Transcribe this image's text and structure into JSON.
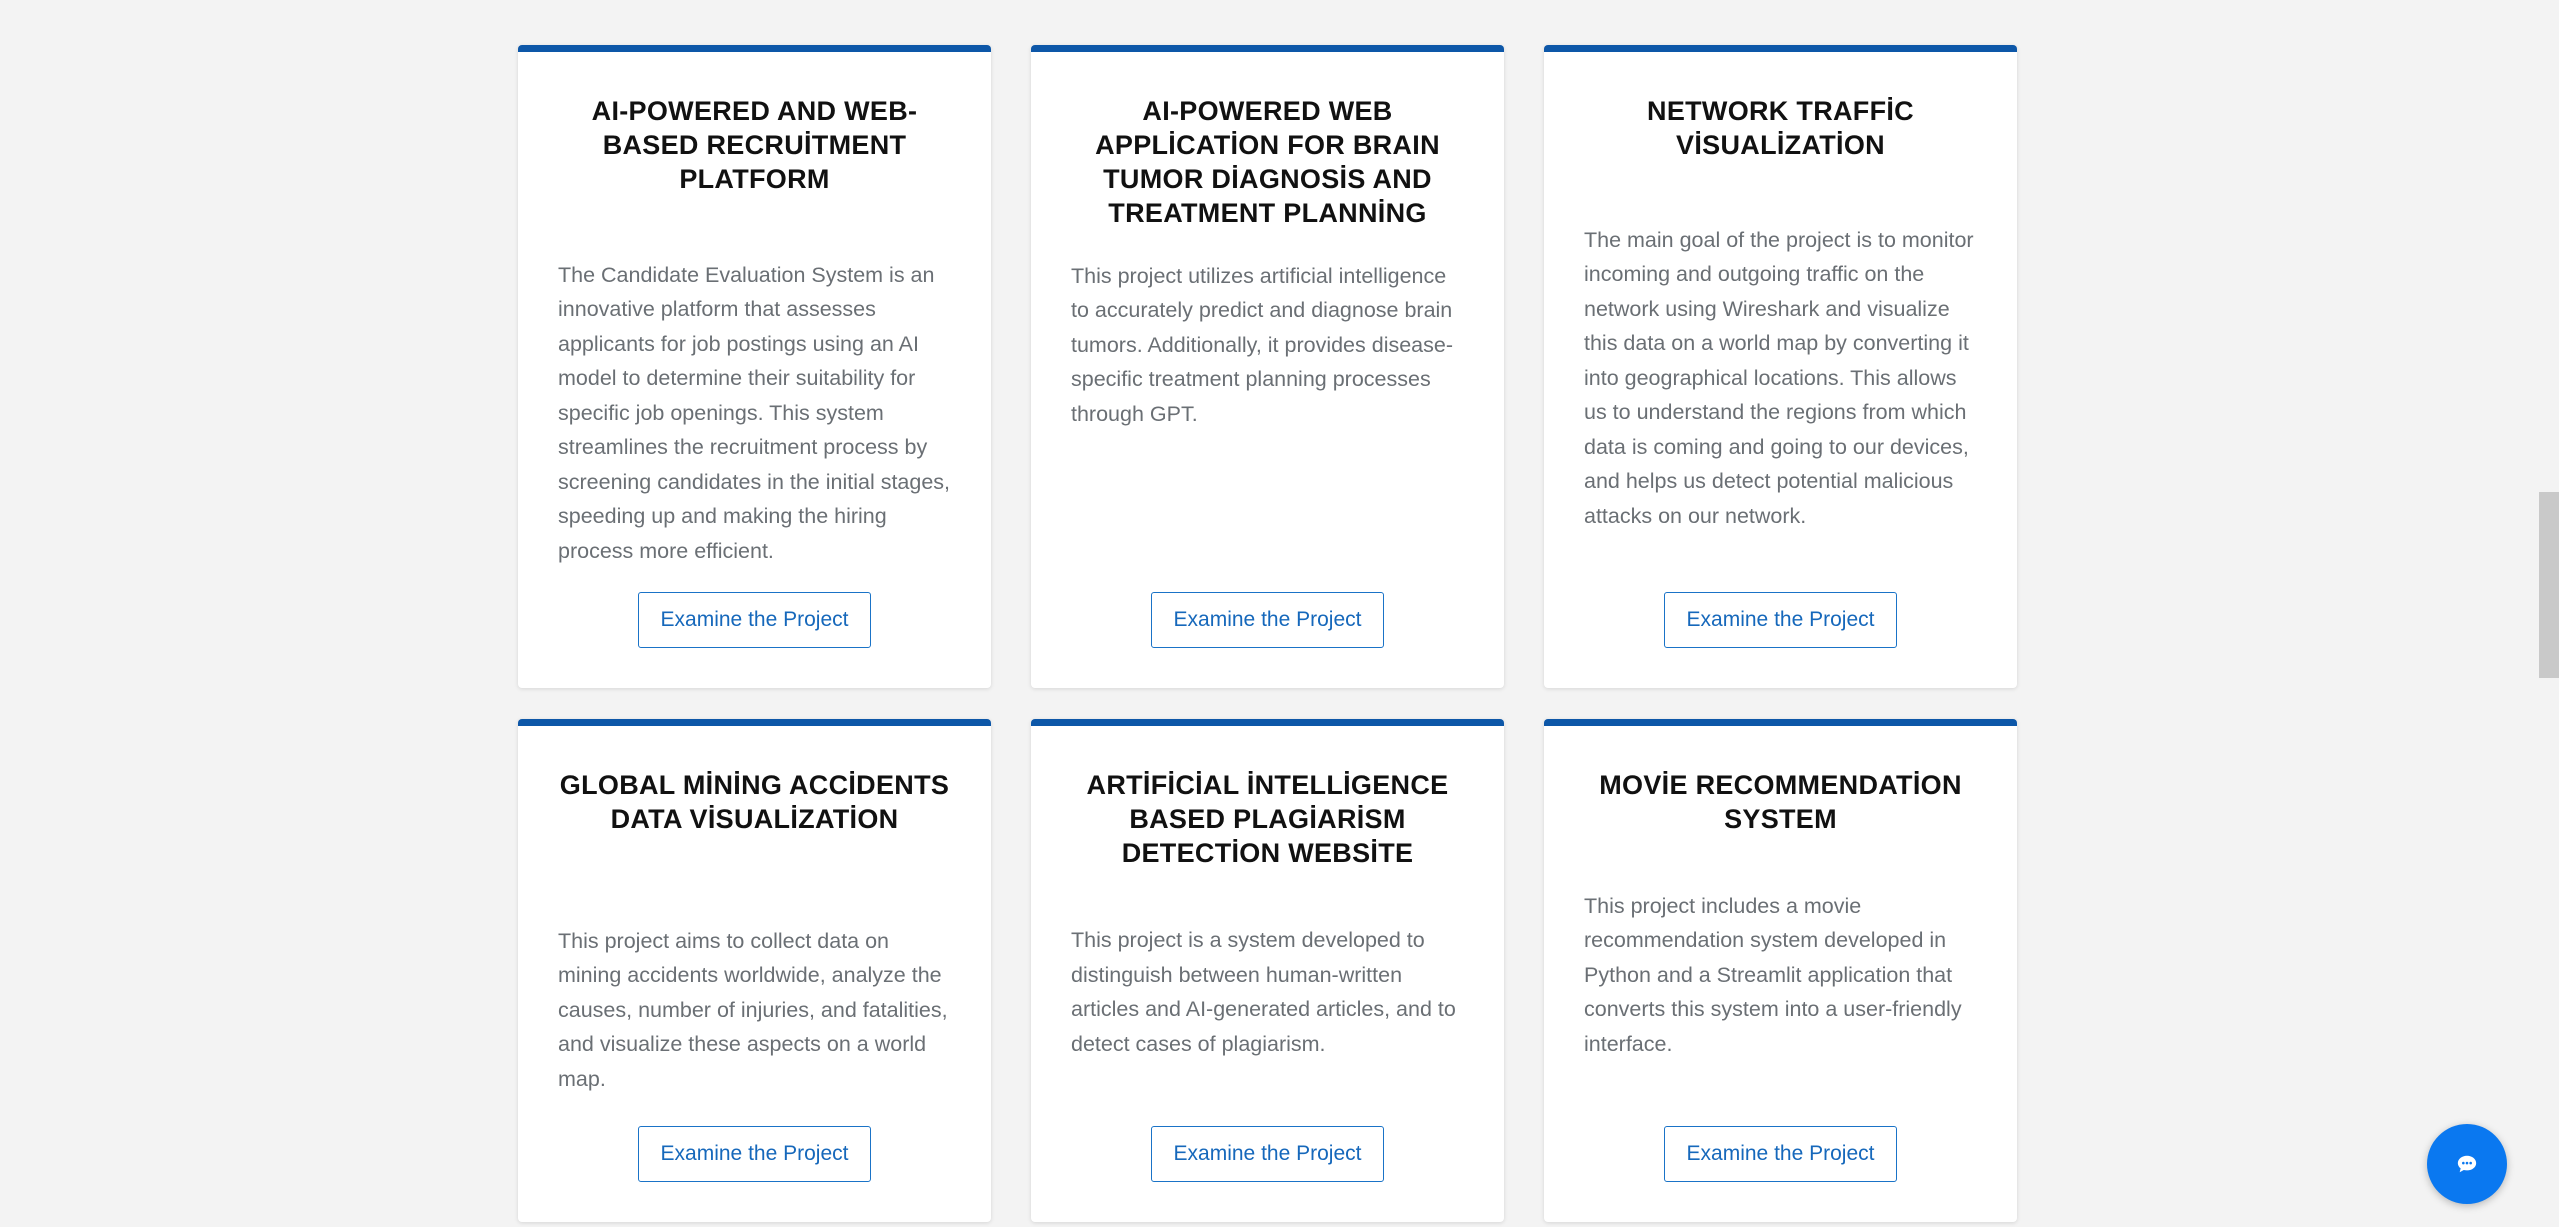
{
  "projects": [
    {
      "title": "AI-POWERED AND WEB-BASED RECRUİTMENT PLATFORM",
      "description": "The Candidate Evaluation System is an innovative platform that assesses applicants for job postings using an AI model to determine their suitability for specific job openings. This system streamlines the recruitment process by screening candidates in the initial stages, speeding up and making the hiring process more efficient.",
      "button": "Examine the Project"
    },
    {
      "title": "AI-POWERED WEB APPLİCATİON FOR BRAIN TUMOR DİAGNOSİS AND TREATMENT PLANNİNG",
      "description": "This project utilizes artificial intelligence to accurately predict and diagnose brain tumors. Additionally, it provides disease-specific treatment planning processes through GPT.",
      "button": "Examine the Project"
    },
    {
      "title": "NETWORK TRAFFİC VİSUALİZATİON",
      "description": "The main goal of the project is to monitor incoming and outgoing traffic on the network using Wireshark and visualize this data on a world map by converting it into geographical locations. This allows us to understand the regions from which data is coming and going to our devices, and helps us detect potential malicious attacks on our network.",
      "button": "Examine the Project"
    },
    {
      "title": "GLOBAL MİNİNG ACCİDENTS DATA VİSUALİZATİON",
      "description": "This project aims to collect data on mining accidents worldwide, analyze the causes, number of injuries, and fatalities, and visualize these aspects on a world map.",
      "button": "Examine the Project"
    },
    {
      "title": "ARTİFİCİAL İNTELLİGENCE BASED PLAGİARİSM DETECTİON WEBSİTE",
      "description": "This project is a system developed to distinguish between human-written articles and AI-generated articles, and to detect cases of plagiarism.",
      "button": "Examine the Project"
    },
    {
      "title": "MOVİE RECOMMENDATİON SYSTEM",
      "description": "This project includes a movie recommendation system developed in Python and a Streamlit application that converts this system into a user-friendly interface.",
      "button": "Examine the Project"
    }
  ],
  "chat": {
    "icon": "chat-bubble-icon"
  },
  "colors": {
    "accent": "#0d57a8",
    "button_text": "#1668bb",
    "chat_button": "#0a78f0",
    "background": "#f3f3f3"
  }
}
